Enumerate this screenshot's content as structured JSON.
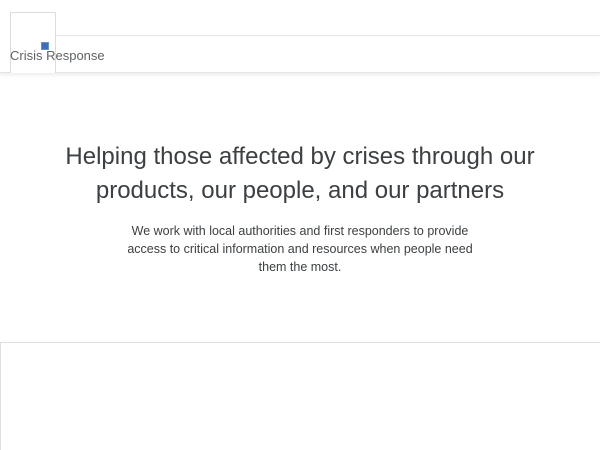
{
  "header": {
    "site_name": "Crisis Response",
    "logo_icon": "broken-image-icon"
  },
  "hero": {
    "title": "Helping those affected by crises through our products, our people, and our partners",
    "body": "We work with local authorities and first responders to provide access to critical information and resources when people need them the most."
  },
  "colors": {
    "text": "#3c4043",
    "muted": "#5f6368",
    "border": "#e0e0e0",
    "logo_blue": "#3d6fb6"
  }
}
